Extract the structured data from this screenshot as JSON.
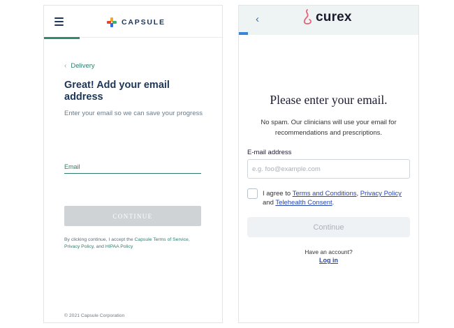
{
  "capsule": {
    "brand": "CAPSULE",
    "back_link": "Delivery",
    "title": "Great! Add your email address",
    "subtitle": "Enter your email so we can save your progress",
    "email_label": "Email",
    "continue_label": "CONTINUE",
    "legal": {
      "prefix": "By clicking continue, I accept the ",
      "terms_link": "Capsule Terms of Service",
      "sep1": ", ",
      "privacy_link": "Privacy Policy",
      "sep2": ", and ",
      "hipaa_link": "HIPAA Policy"
    },
    "footer": "© 2021 Capsule Corporation",
    "colors": {
      "accent": "#2e7d6b",
      "title": "#1d3557",
      "disabled_button": "#cfd3d6"
    }
  },
  "curex": {
    "brand": "curex",
    "title": "Please enter your email.",
    "subtitle": "No spam. Our clinicians will use your email for recommendations and prescriptions.",
    "email_label": "E-mail address",
    "email_placeholder": "e.g. foo@example.com",
    "agree": {
      "prefix": "I agree to ",
      "terms_link": "Terms and Conditions",
      "sep1": ", ",
      "privacy_link": "Privacy Policy",
      "sep2": " and ",
      "telehealth_link": "Telehealth Consent",
      "suffix": "."
    },
    "continue_label": "Continue",
    "have_account": "Have an account?",
    "login_link": "Log in",
    "colors": {
      "link": "#2747b0",
      "header_bg": "#eef3f3",
      "logo_swirl": "#e8617a"
    }
  }
}
